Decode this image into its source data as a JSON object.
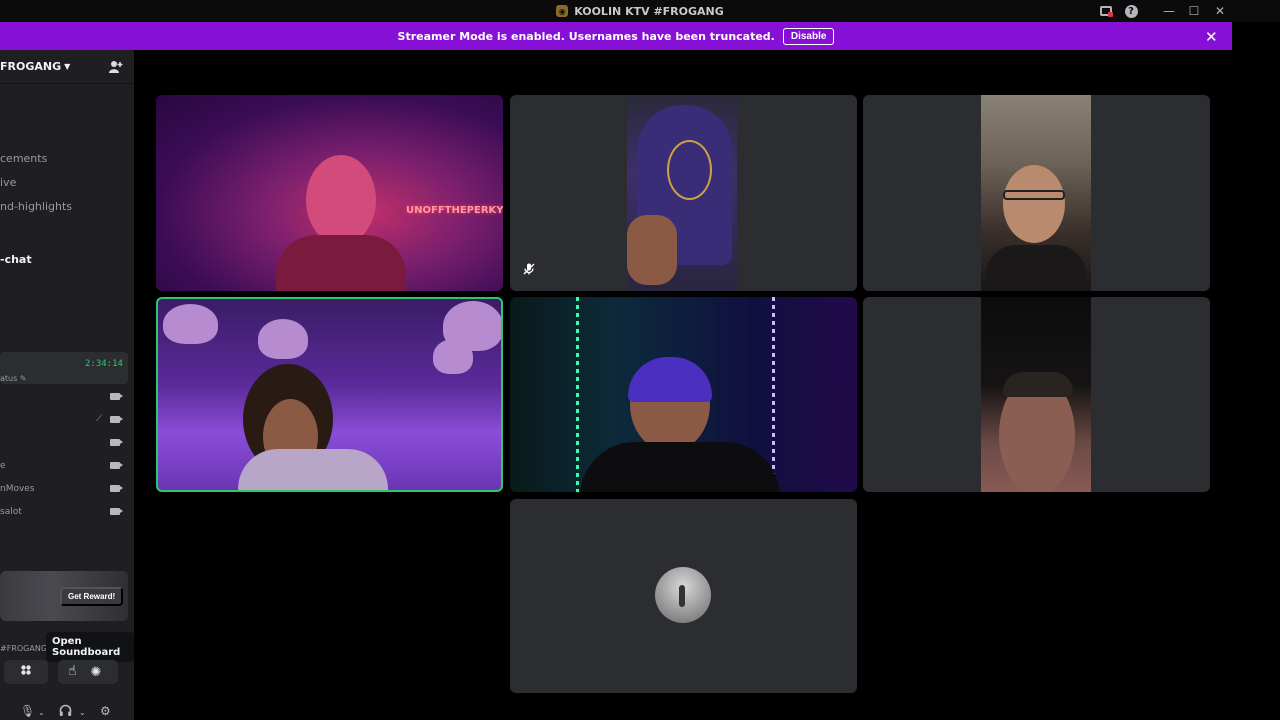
{
  "window": {
    "title": "KOOLIN KTV #FROGANG"
  },
  "banner": {
    "message": "Streamer Mode is enabled. Usernames have been truncated.",
    "disable_label": "Disable"
  },
  "sidebar": {
    "server_name": "FROGANG",
    "channels": [
      {
        "label": "cements",
        "active": false
      },
      {
        "label": "ive",
        "active": false
      },
      {
        "label": "nd-highlights",
        "active": false
      },
      {
        "label": "-chat",
        "active": true
      }
    ],
    "voice": {
      "timer": "2:34:14",
      "status": "atus"
    },
    "members": [
      {
        "name": "",
        "muted": false
      },
      {
        "name": "",
        "muted": true
      },
      {
        "name": "",
        "muted": false
      },
      {
        "name": "e",
        "muted": false
      },
      {
        "name": "nMoves",
        "muted": false
      },
      {
        "name": "salot",
        "muted": false
      }
    ],
    "reward_button": "Get Reward!",
    "server_label": "#FROGANG",
    "tooltip": "Open Soundboard"
  },
  "icons": {
    "invite": "add-user-icon",
    "camera": "camera-icon",
    "mute": "mic-muted-icon",
    "activity": "activity-icon",
    "soundboard": "soundboard-icon",
    "mic": "mic-icon",
    "headphones": "headphones-icon",
    "settings": "gear-icon"
  },
  "colors": {
    "banner": "#8610d6",
    "speaking_border": "#2dc770",
    "sidebar": "#1f1f22",
    "tile": "#2b2d31"
  },
  "tiles": [
    {
      "id": "tile-1",
      "neon_text": "UNOFFTHEPERKY"
    },
    {
      "id": "tile-2",
      "muted": true
    },
    {
      "id": "tile-3"
    },
    {
      "id": "tile-4",
      "speaking": true
    },
    {
      "id": "tile-5"
    },
    {
      "id": "tile-6"
    },
    {
      "id": "tile-7",
      "avatar_only": true
    }
  ]
}
